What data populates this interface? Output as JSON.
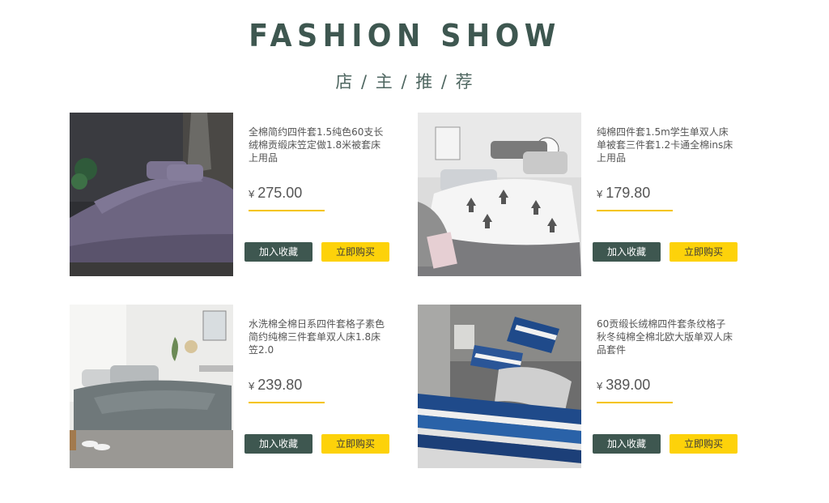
{
  "header": {
    "title": "FASHION SHOW",
    "subtitle": "店 / 主 / 推 / 荐"
  },
  "products": [
    {
      "name": "全棉简约四件套1.5纯色60支长绒棉贡缎床笠定做1.8米被套床上用品",
      "currency": "¥",
      "price": "275.00",
      "fav_label": "加入收藏",
      "buy_label": "立即购买"
    },
    {
      "name": "纯棉四件套1.5m学生单双人床单被套三件套1.2卡通全棉ins床上用品",
      "currency": "¥",
      "price": "179.80",
      "fav_label": "加入收藏",
      "buy_label": "立即购买"
    },
    {
      "name": "水洗棉全棉日系四件套格子素色简约纯棉三件套单双人床1.8床笠2.0",
      "currency": "¥",
      "price": "239.80",
      "fav_label": "加入收藏",
      "buy_label": "立即购买"
    },
    {
      "name": "60贡缎长绒棉四件套条纹格子秋冬纯棉全棉北欧大版单双人床品套件",
      "currency": "¥",
      "price": "389.00",
      "fav_label": "加入收藏",
      "buy_label": "立即购买"
    }
  ],
  "colors": {
    "title": "#3e5750",
    "fav_button": "#3e5750",
    "buy_button": "#fdd20a",
    "price_underline": "#f5c400"
  }
}
